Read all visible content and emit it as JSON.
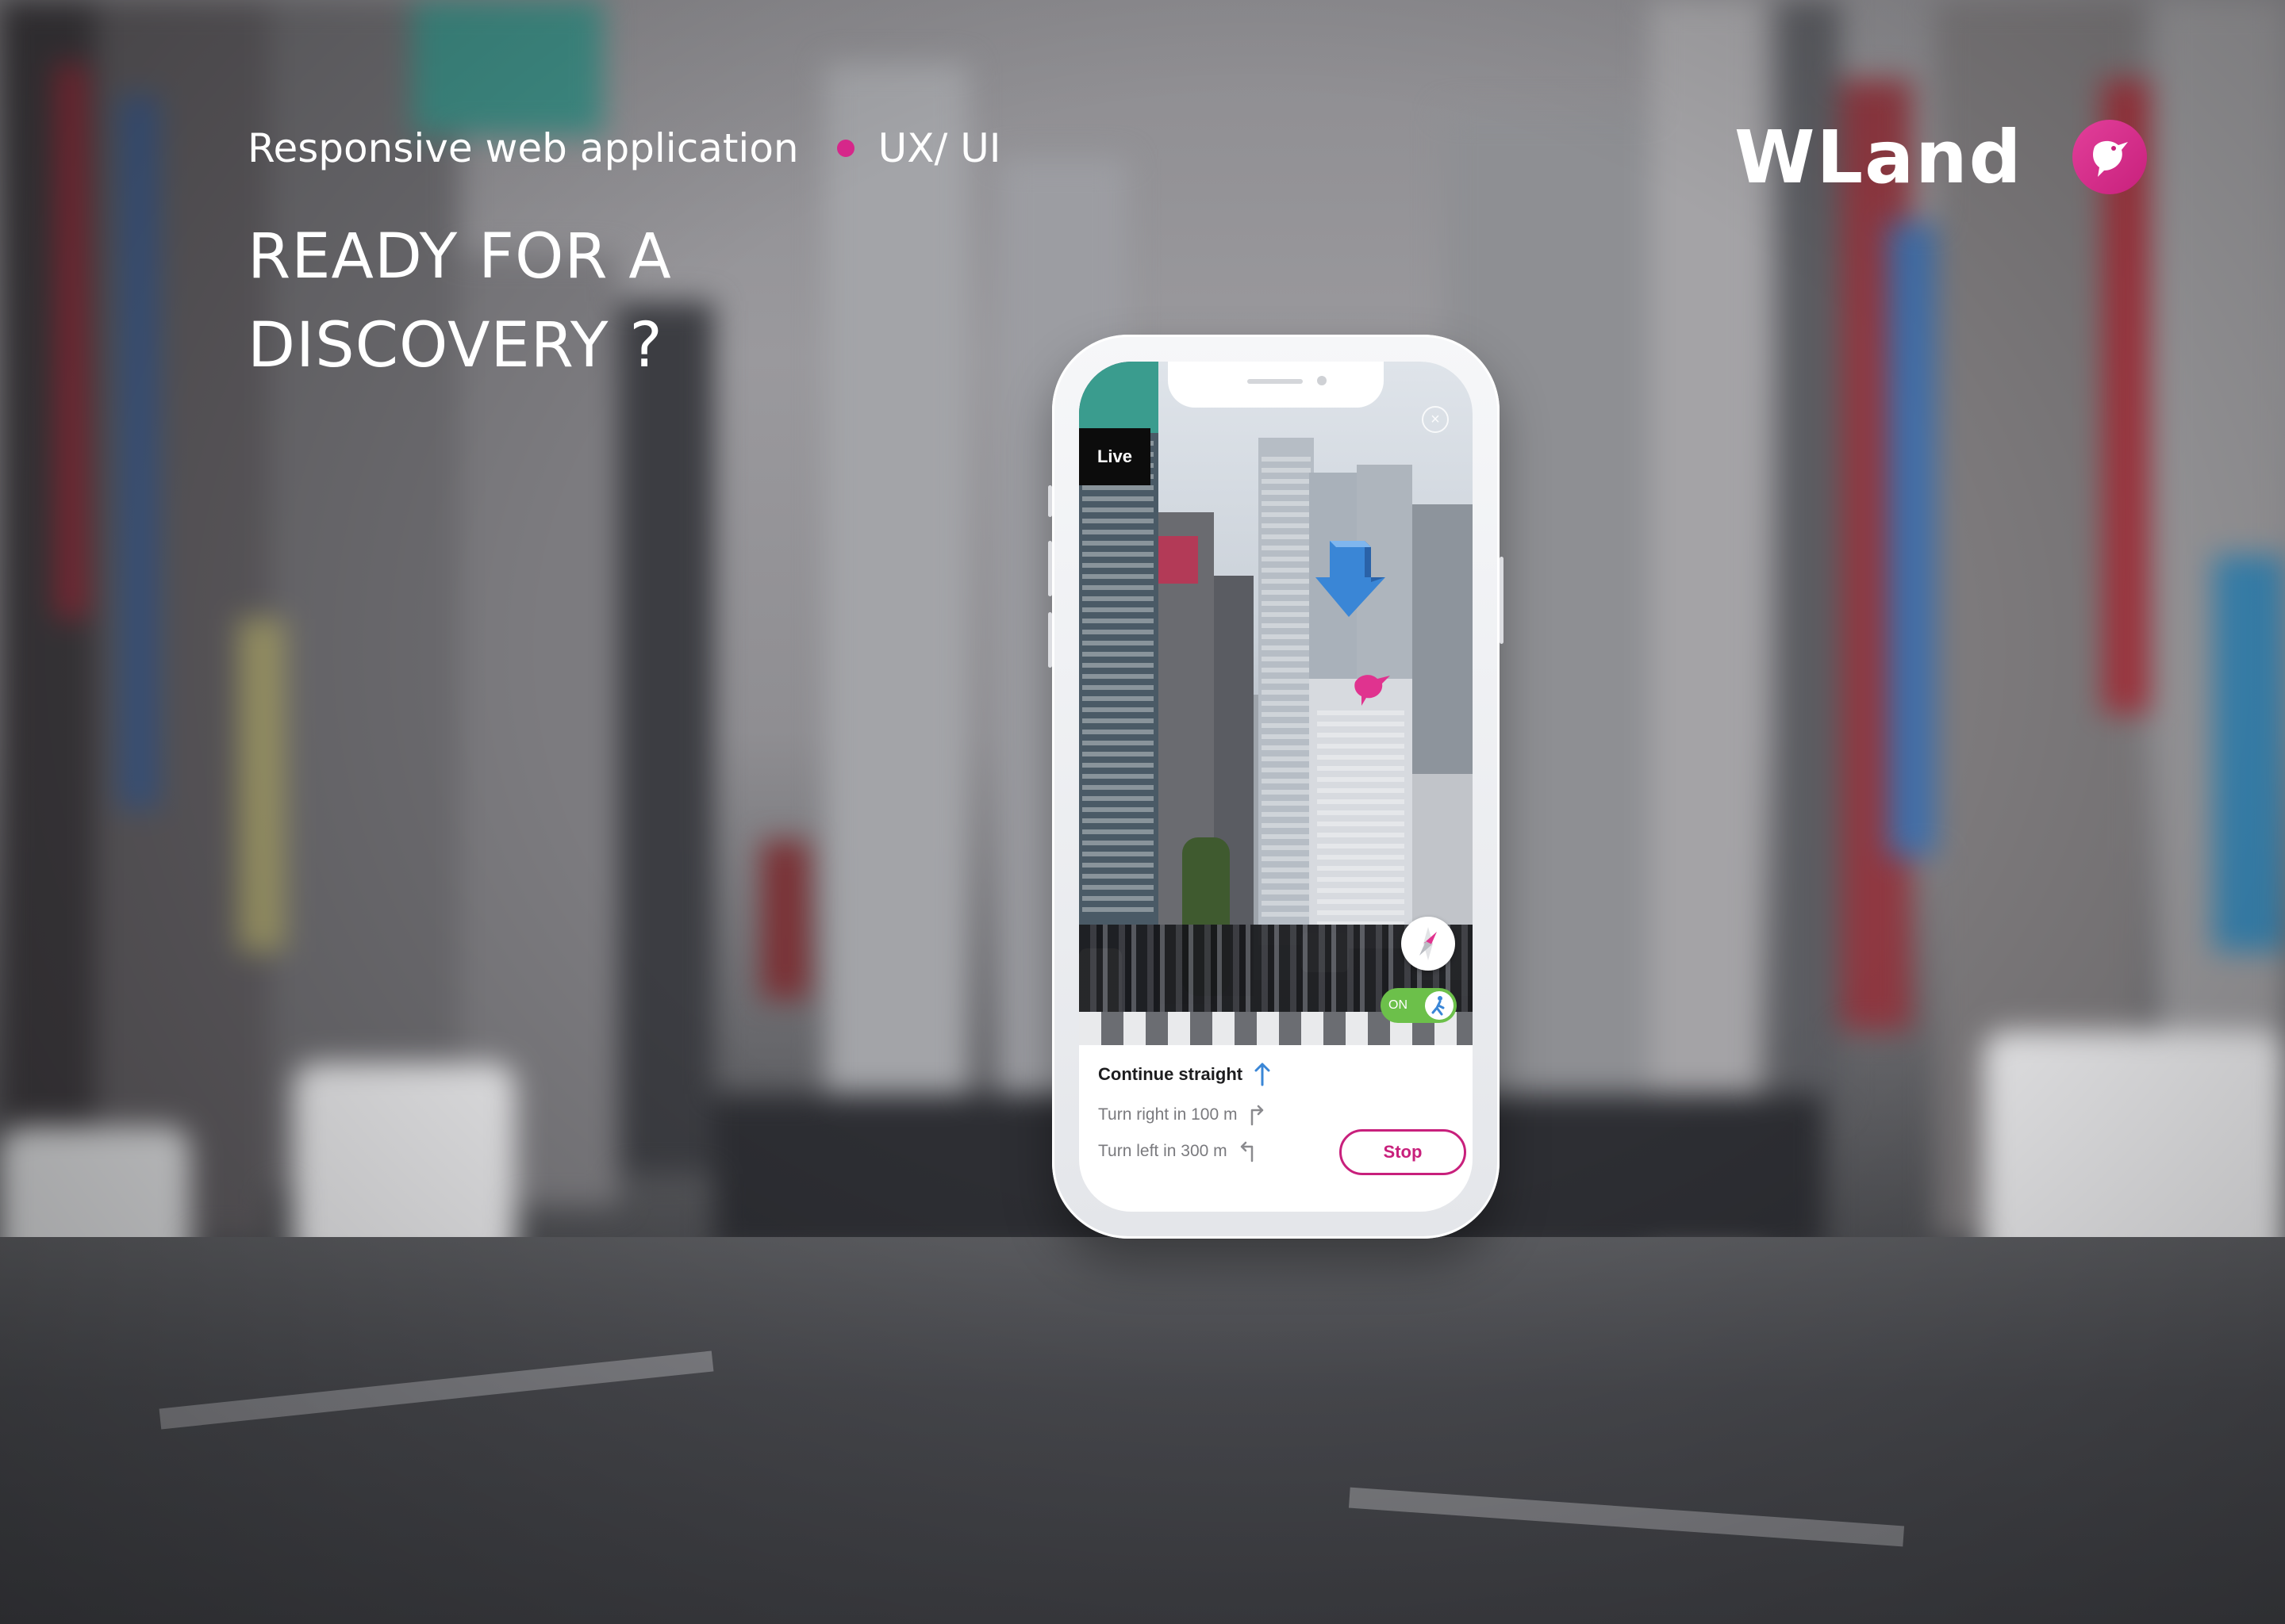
{
  "header": {
    "subtitle": "Responsive web application",
    "tag": "UX/ UI",
    "headline_line1": "READY FOR A",
    "headline_line2": "DISCOVERY ?"
  },
  "brand": {
    "name": "WLand",
    "logo_icon": "bird-icon",
    "accent_color": "#c8207c"
  },
  "app": {
    "live_label": "Live",
    "close_icon": "close-icon",
    "ar_arrow_icon": "arrow-down-3d-icon",
    "marker_icon": "bird-marker-icon",
    "compass_icon": "compass-icon",
    "toggle": {
      "label": "ON",
      "state": true
    },
    "directions": [
      {
        "text": "Continue straight",
        "icon": "arrow-up-icon",
        "current": true
      },
      {
        "text": "Turn right in 100 m",
        "icon": "turn-right-icon",
        "current": false
      },
      {
        "text": "Turn left in 300 m",
        "icon": "turn-left-icon",
        "current": false
      }
    ],
    "stop_label": "Stop"
  }
}
